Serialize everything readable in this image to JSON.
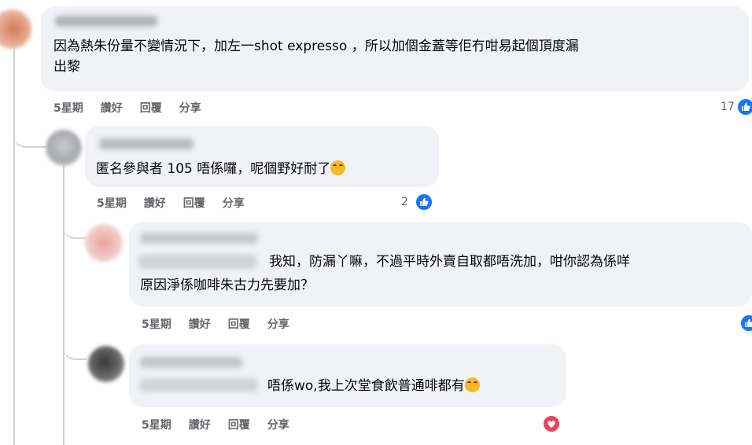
{
  "comments": [
    {
      "text_line1": "因為熱朱份量不變情況下，加左一shot expresso ，所以加個金蓋等佢冇咁易起個頂度漏",
      "text_line2": "出黎",
      "time": "5星期",
      "like": "讚好",
      "reply": "回覆",
      "share": "分享",
      "reaction_count": "17",
      "reaction_icon": "like-icon"
    },
    {
      "text_line1": "匿名參與者 105 唔係囉，呢個野好耐了",
      "emoji_icon": "upside-down-face-emoji",
      "time": "5星期",
      "like": "讚好",
      "reply": "回覆",
      "share": "分享",
      "reaction_count": "2",
      "reaction_icon": "like-icon"
    },
    {
      "text_line1": "我知，防漏丫嘛，不過平時外賣自取都唔洗加，咁你認為係咩",
      "text_line2": "原因淨係咖啡朱古力先要加？",
      "time": "5星期",
      "like": "讚好",
      "reply": "回覆",
      "share": "分享",
      "reaction_icon": "like-icon"
    },
    {
      "text_line1": "唔係wo,我上次堂食飲普通啡都有",
      "emoji_icon": "hugging-face-emoji",
      "time": "5星期",
      "like": "讚好",
      "reply": "回覆",
      "share": "分享",
      "reaction_icon": "love-icon"
    }
  ],
  "colors": {
    "bubble": "#f0f2f5",
    "meta_text": "#65676b",
    "like_blue": "#1877f2",
    "love_red": "#f33e58",
    "thread_line": "#ced0d4"
  }
}
